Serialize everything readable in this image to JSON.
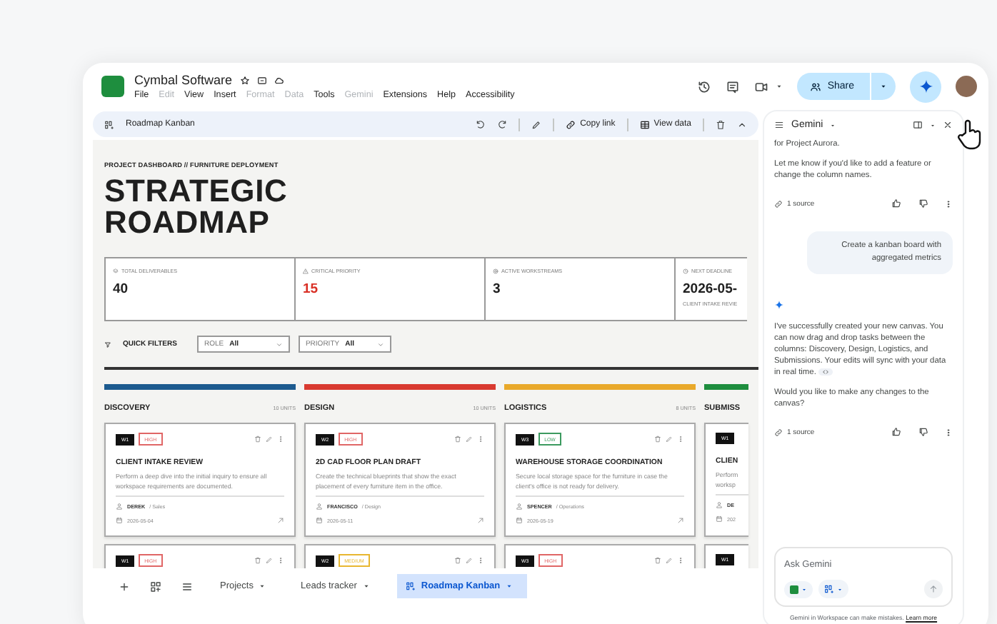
{
  "document": {
    "title": "Cymbal Software"
  },
  "menu": [
    {
      "label": "File",
      "disabled": false
    },
    {
      "label": "Edit",
      "disabled": true
    },
    {
      "label": "View",
      "disabled": false
    },
    {
      "label": "Insert",
      "disabled": false
    },
    {
      "label": "Format",
      "disabled": true
    },
    {
      "label": "Data",
      "disabled": true
    },
    {
      "label": "Tools",
      "disabled": false
    },
    {
      "label": "Gemini",
      "disabled": true
    },
    {
      "label": "Extensions",
      "disabled": false
    },
    {
      "label": "Help",
      "disabled": false
    },
    {
      "label": "Accessibility",
      "disabled": false
    }
  ],
  "share_button": "Share",
  "toolbar": {
    "title": "Roadmap Kanban",
    "copy_link": "Copy link",
    "view_data": "View data"
  },
  "dashboard": {
    "breadcrumb": "PROJECT DASHBOARD // FURNITURE DEPLOYMENT",
    "title": "STRATEGIC ROADMAP",
    "stats": [
      {
        "label": "TOTAL DELIVERABLES",
        "value": "40",
        "kind": "normal"
      },
      {
        "label": "CRITICAL PRIORITY",
        "value": "15",
        "kind": "alert"
      },
      {
        "label": "ACTIVE WORKSTREAMS",
        "value": "3",
        "kind": "normal"
      },
      {
        "label": "NEXT DEADLINE",
        "value": "2026-05-",
        "sub": "CLIENT INTAKE REVIE",
        "kind": "normal"
      }
    ],
    "filters_label": "QUICK FILTERS",
    "filters": [
      {
        "label": "ROLE",
        "value": "All"
      },
      {
        "label": "PRIORITY",
        "value": "All"
      }
    ],
    "columns": [
      {
        "name": "DISCOVERY",
        "count": "10 UNITS",
        "color": "#1d5b8f",
        "kind": "full",
        "cards": [
          {
            "id": "W1",
            "priority": {
              "label": "HIGH",
              "color": "#e06666"
            },
            "title": "CLIENT INTAKE REVIEW",
            "description": "Perform a deep dive into the initial inquiry to ensure all workspace requirements are documented.",
            "assignee": "DEREK",
            "role": "/ Sales",
            "date": "2026-05-04"
          },
          {
            "id": "W1",
            "priority": {
              "label": "HIGH",
              "color": "#e06666"
            }
          }
        ]
      },
      {
        "name": "DESIGN",
        "count": "10 UNITS",
        "color": "#d93a30",
        "kind": "full",
        "cards": [
          {
            "id": "W2",
            "priority": {
              "label": "HIGH",
              "color": "#e06666"
            },
            "title": "2D CAD FLOOR PLAN DRAFT",
            "description": "Create the technical blueprints that show the exact placement of every furniture item in the office.",
            "assignee": "FRANCISCO",
            "role": "/ Design",
            "date": "2026-05-11"
          },
          {
            "id": "W2",
            "priority": {
              "label": "MEDIUM",
              "color": "#e8b730"
            }
          }
        ]
      },
      {
        "name": "LOGISTICS",
        "count": "8 UNITS",
        "color": "#e9a92a",
        "kind": "full",
        "cards": [
          {
            "id": "W3",
            "priority": {
              "label": "LOW",
              "color": "#3c9a5f"
            },
            "title": "WAREHOUSE STORAGE COORDINATION",
            "description": "Secure local storage space for the furniture in case the client's office is not ready for delivery.",
            "assignee": "SPENCER",
            "role": "/ Operations",
            "date": "2026-05-19"
          },
          {
            "id": "W3",
            "priority": {
              "label": "HIGH",
              "color": "#e06666"
            }
          }
        ]
      },
      {
        "name": "SUBMISS",
        "color": "#1e8e3e",
        "kind": "partial",
        "cards": [
          {
            "id": "W1",
            "title": "CLIEN",
            "description": "Perform worksp",
            "assignee": "DE",
            "date": "202"
          },
          {
            "id": "W1"
          }
        ]
      }
    ]
  },
  "sheet_tabs": [
    {
      "label": "Projects",
      "selected": false
    },
    {
      "label": "Leads tracker",
      "selected": false
    },
    {
      "label": "Roadmap Kanban",
      "selected": true
    }
  ],
  "gemini": {
    "title": "Gemini",
    "messages": [
      {
        "kind": "model",
        "paragraphs": [
          "for Project Aurora.",
          "Let me know if you'd like to add a feature or change the column names."
        ],
        "sources": "1 source",
        "code_chip": false
      },
      {
        "kind": "user",
        "text": "Create a kanban board with aggregated metrics"
      },
      {
        "kind": "model",
        "paragraphs": [
          "I've successfully created your new canvas. You can now drag and drop tasks between the columns: Discovery, Design, Logistics, and Submissions. Your edits will sync with your data in real time.",
          "Would you like to make any changes to the canvas?"
        ],
        "sources": "1 source",
        "code_chip": true,
        "sparkle": true
      }
    ],
    "input_placeholder": "Ask Gemini",
    "disclaimer": "Gemini in Workspace can make mistakes.",
    "learn_more": "Learn more"
  }
}
